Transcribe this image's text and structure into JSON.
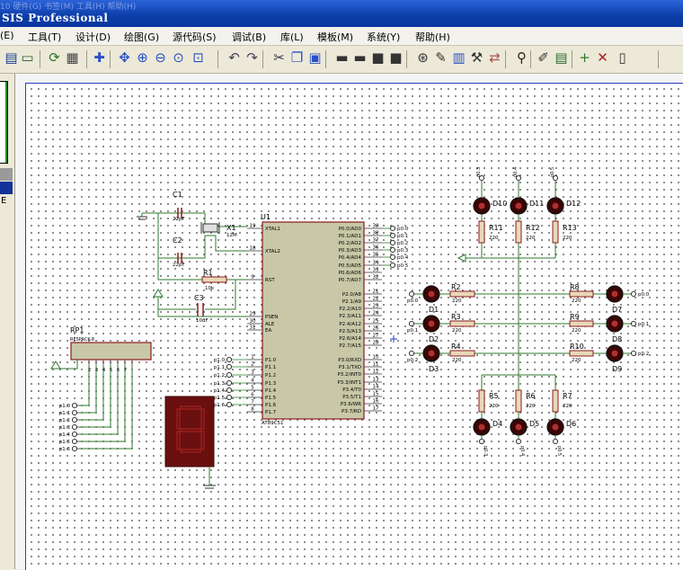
{
  "window": {
    "title": "SIS Professional",
    "ghost_text": "10   硬件(G)   书签(M)   工具(H)   帮助(H)"
  },
  "menu": {
    "items": [
      "(E)",
      "工具(T)",
      "设计(D)",
      "绘图(G)",
      "源代码(S)",
      "调试(B)",
      "库(L)",
      "模板(M)",
      "系统(Y)",
      "帮助(H)"
    ]
  },
  "left_panel": {
    "label": "E"
  },
  "toolbar": {
    "icons": [
      "save-icon",
      "page-icon",
      "refresh-icon",
      "grid-icon",
      "origin-icon",
      "pan-icon",
      "zoom-in-icon",
      "zoom-out-icon",
      "zoom-all-icon",
      "zoom-area-icon",
      "undo-icon",
      "redo-icon",
      "cut-icon",
      "copy-icon",
      "paste-icon",
      "block-copy-icon",
      "block-move-icon",
      "block-rotate-icon",
      "block-delete-icon",
      "pick-device-icon",
      "make-device-icon",
      "packaging-icon",
      "decompose-icon",
      "wire-autorouter-icon",
      "search-icon",
      "property-assign-icon",
      "design-explorer-icon",
      "new-sheet-icon",
      "remove-sheet-icon",
      "netlist-icon"
    ]
  },
  "schematic": {
    "mcu": {
      "ref": "U1",
      "part": "AT89C51",
      "left_pins": [
        {
          "num": "19",
          "name": "XTAL1"
        },
        {
          "num": "18",
          "name": "XTAL2"
        },
        {
          "num": "9",
          "name": "RST"
        },
        {
          "num": "29",
          "name": "PSEN"
        },
        {
          "num": "30",
          "name": "ALE"
        },
        {
          "num": "31",
          "name": "EA"
        },
        {
          "num": "1",
          "name": "P1.0"
        },
        {
          "num": "2",
          "name": "P1.1"
        },
        {
          "num": "3",
          "name": "P1.2"
        },
        {
          "num": "4",
          "name": "P1.3"
        },
        {
          "num": "5",
          "name": "P1.4"
        },
        {
          "num": "6",
          "name": "P1.5"
        },
        {
          "num": "7",
          "name": "P1.6"
        },
        {
          "num": "8",
          "name": "P1.7"
        }
      ],
      "right_pins": [
        {
          "num": "39",
          "name": "P0.0/AD0"
        },
        {
          "num": "38",
          "name": "P0.1/AD1"
        },
        {
          "num": "37",
          "name": "P0.2/AD2"
        },
        {
          "num": "36",
          "name": "P0.3/AD3"
        },
        {
          "num": "35",
          "name": "P0.4/AD4"
        },
        {
          "num": "34",
          "name": "P0.5/AD5"
        },
        {
          "num": "33",
          "name": "P0.6/AD6"
        },
        {
          "num": "32",
          "name": "P0.7/AD7"
        },
        {
          "num": "21",
          "name": "P2.0/A8"
        },
        {
          "num": "22",
          "name": "P2.1/A9"
        },
        {
          "num": "23",
          "name": "P2.2/A10"
        },
        {
          "num": "24",
          "name": "P2.3/A11"
        },
        {
          "num": "25",
          "name": "P2.4/A12"
        },
        {
          "num": "26",
          "name": "P2.5/A13"
        },
        {
          "num": "27",
          "name": "P2.6/A14"
        },
        {
          "num": "28",
          "name": "P2.7/A15"
        },
        {
          "num": "10",
          "name": "P3.0/RXD"
        },
        {
          "num": "11",
          "name": "P3.1/TXD"
        },
        {
          "num": "12",
          "name": "P3.2/INT0"
        },
        {
          "num": "13",
          "name": "P3.3/INT1"
        },
        {
          "num": "14",
          "name": "P3.4/T0"
        },
        {
          "num": "15",
          "name": "P3.5/T1"
        },
        {
          "num": "16",
          "name": "P3.6/WR"
        },
        {
          "num": "17",
          "name": "P3.7/RD"
        }
      ],
      "p0_terminals": [
        "p0.0",
        "p0.1",
        "p0.2",
        "p0.3",
        "p0.4",
        "p0.5"
      ],
      "p1_terminals": [
        "p1.0",
        "p1.1",
        "p1.2",
        "p1.3",
        "p1.4",
        "p1.5",
        "p1.6"
      ]
    },
    "crystal": {
      "ref": "X1",
      "value": "12M"
    },
    "capacitors": [
      {
        "ref": "C1",
        "value": "22pF"
      },
      {
        "ref": "C2",
        "value": "22pF"
      },
      {
        "ref": "C3",
        "value": "10uF"
      }
    ],
    "reset_resistor": {
      "ref": "R1",
      "value": "10k"
    },
    "resistor_pack": {
      "ref": "RP1",
      "part": "RESPACK-8"
    },
    "rp_terminals": [
      "p1.0",
      "p1.1",
      "p1.2",
      "p1.3",
      "p1.4",
      "p1.5",
      "p1.6"
    ],
    "top_leds": [
      {
        "ref": "D10",
        "net": "p0.3"
      },
      {
        "ref": "D11",
        "net": "p0.4"
      },
      {
        "ref": "D12",
        "net": "p0.5"
      }
    ],
    "top_resistors": [
      {
        "ref": "R11",
        "value": "220"
      },
      {
        "ref": "R12",
        "value": "220"
      },
      {
        "ref": "R13",
        "value": "220"
      }
    ],
    "left_leds": [
      {
        "ref": "D1",
        "net": "p0.0"
      },
      {
        "ref": "D2",
        "net": "p0.1"
      },
      {
        "ref": "D3",
        "net": "p0.2"
      }
    ],
    "left_resistors": [
      {
        "ref": "R2",
        "value": "220"
      },
      {
        "ref": "R3",
        "value": "220"
      },
      {
        "ref": "R4",
        "value": "220"
      }
    ],
    "right_resistors": [
      {
        "ref": "R8",
        "value": "220"
      },
      {
        "ref": "R9",
        "value": "220"
      },
      {
        "ref": "R10",
        "value": "220"
      }
    ],
    "right_leds": [
      {
        "ref": "D7",
        "net": "p0.0"
      },
      {
        "ref": "D8",
        "net": "p0.1"
      },
      {
        "ref": "D9",
        "net": "p0.2"
      }
    ],
    "bottom_resistors": [
      {
        "ref": "R5",
        "value": "220"
      },
      {
        "ref": "R6",
        "value": "220"
      },
      {
        "ref": "R7",
        "value": "220"
      }
    ],
    "bottom_leds": [
      {
        "ref": "D4",
        "net": "p0.3"
      },
      {
        "ref": "D5",
        "net": "p0.4"
      },
      {
        "ref": "D6",
        "net": "p0.5"
      }
    ],
    "colors": {
      "wire": "#2f7a2f",
      "component": "#8b1c1c",
      "chip_fill": "#c8c8a8",
      "led_fill": "#3a0505",
      "seg_fill": "#6a0f0f"
    }
  }
}
